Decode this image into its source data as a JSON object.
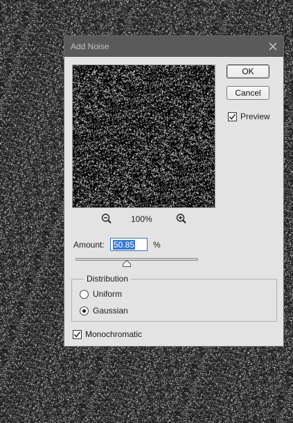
{
  "dialog": {
    "title": "Add Noise",
    "zoom_level": "100%",
    "buttons": {
      "ok": "OK",
      "cancel": "Cancel"
    },
    "preview": {
      "label": "Preview",
      "checked": true
    },
    "amount": {
      "label": "Amount:",
      "value": "50.85",
      "unit": "%",
      "slider_fraction": 0.42
    },
    "distribution": {
      "title": "Distribution",
      "options": [
        {
          "label": "Uniform",
          "selected": false
        },
        {
          "label": "Gaussian",
          "selected": true
        }
      ]
    },
    "monochromatic": {
      "label": "Monochromatic",
      "checked": true
    }
  },
  "icons": {
    "close": "close-icon",
    "zoom_out": "zoom-out-icon",
    "zoom_in": "zoom-in-icon",
    "check": "checkmark-icon"
  }
}
